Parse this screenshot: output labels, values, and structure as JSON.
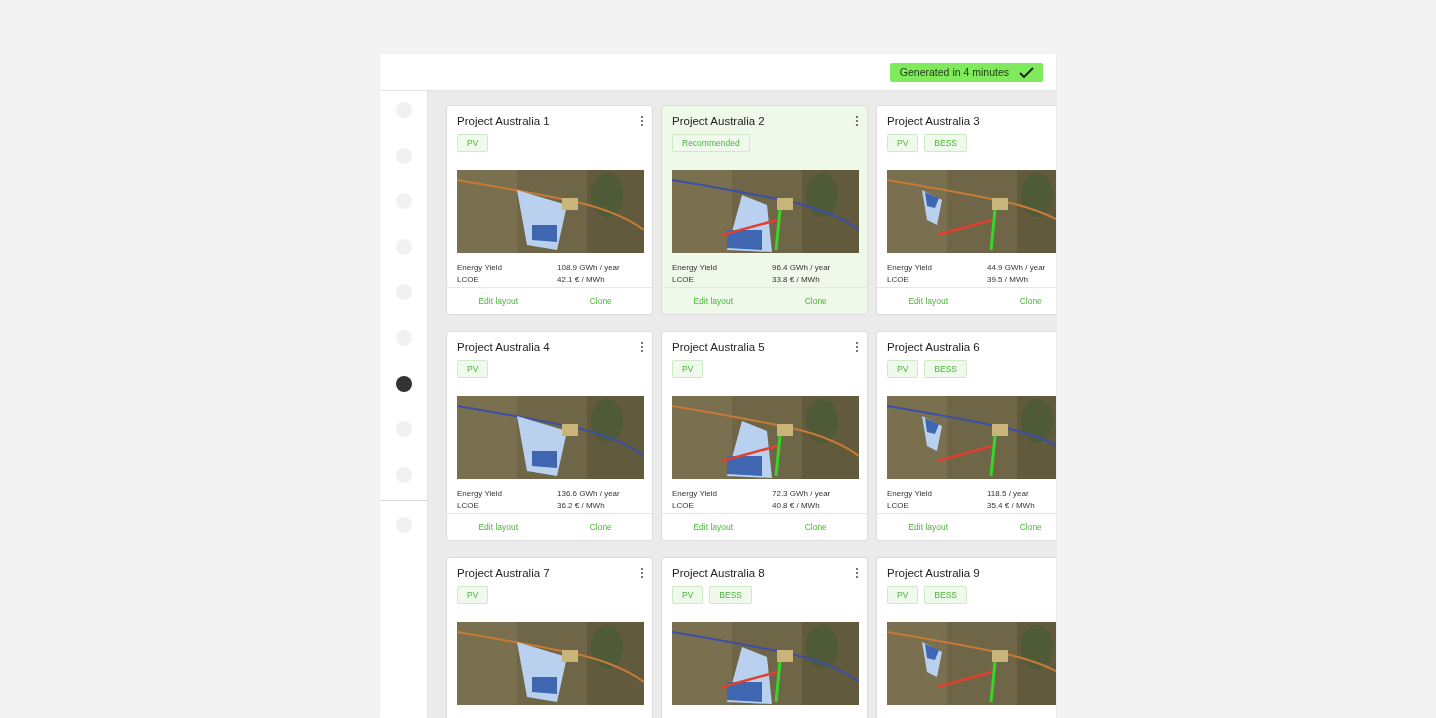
{
  "header": {
    "status_badge": "Generated in 4 minutes"
  },
  "sidebar": {
    "items": [
      {
        "selected": false
      },
      {
        "selected": false
      },
      {
        "selected": false
      },
      {
        "selected": false
      },
      {
        "selected": false
      },
      {
        "selected": false
      },
      {
        "selected": true
      },
      {
        "selected": false
      },
      {
        "selected": false
      }
    ],
    "footer_items": [
      {
        "selected": false
      }
    ]
  },
  "projects": [
    {
      "title": "Project Australia 1",
      "recommended": false,
      "tags": [
        "PV"
      ],
      "stats": [
        {
          "label": "Energy Yield",
          "value": "108.9 GWh / year"
        },
        {
          "label": "LCOE",
          "value": "42.1 € / MWh"
        }
      ],
      "actions": [
        "Edit layout",
        "Clone"
      ]
    },
    {
      "title": "Project Australia 2",
      "recommended": true,
      "tags": [
        "Recommended"
      ],
      "stats": [
        {
          "label": "Energy Yield",
          "value": "96.4 GWh / year"
        },
        {
          "label": "LCOE",
          "value": "33.8 € / MWh"
        }
      ],
      "actions": [
        "Edit layout",
        "Clone"
      ]
    },
    {
      "title": "Project Australia 3",
      "recommended": false,
      "tags": [
        "PV",
        "BESS"
      ],
      "stats": [
        {
          "label": "Energy Yield",
          "value": "44.9 GWh / year"
        },
        {
          "label": "LCOE",
          "value": "39.5 / MWh"
        }
      ],
      "actions": [
        "Edit layout",
        "Clone"
      ]
    },
    {
      "title": "Project Australia 4",
      "recommended": false,
      "tags": [
        "PV"
      ],
      "stats": [
        {
          "label": "Energy Yield",
          "value": "136.6 GWh / year"
        },
        {
          "label": "LCOE",
          "value": "36.2 € / MWh"
        }
      ],
      "actions": [
        "Edit layout",
        "Clone"
      ]
    },
    {
      "title": "Project Australia 5",
      "recommended": false,
      "tags": [
        "PV"
      ],
      "stats": [
        {
          "label": "Energy Yield",
          "value": "72.3 GWh / year"
        },
        {
          "label": "LCOE",
          "value": "40.8 € / MWh"
        }
      ],
      "actions": [
        "Edit layout",
        "Clone"
      ]
    },
    {
      "title": "Project Australia 6",
      "recommended": false,
      "tags": [
        "PV",
        "BESS"
      ],
      "stats": [
        {
          "label": "Energy Yield",
          "value": "118.5 / year"
        },
        {
          "label": "LCOE",
          "value": "35.4 € / MWh"
        }
      ],
      "actions": [
        "Edit layout",
        "Clone"
      ]
    },
    {
      "title": "Project Australia 7",
      "recommended": false,
      "tags": [
        "PV"
      ]
    },
    {
      "title": "Project Australia 8",
      "recommended": false,
      "tags": [
        "PV",
        "BESS"
      ]
    },
    {
      "title": "Project Australia 9",
      "recommended": false,
      "tags": [
        "PV",
        "BESS"
      ]
    }
  ]
}
